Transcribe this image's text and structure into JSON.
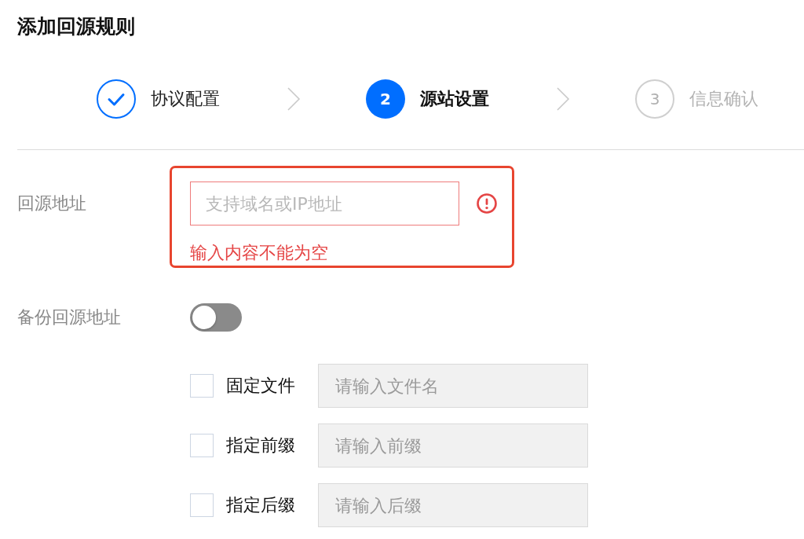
{
  "title": "添加回源规则",
  "steps": [
    {
      "label": "协议配置",
      "completed": true,
      "selected": false
    },
    {
      "number": "2",
      "label": "源站设置",
      "completed": false,
      "selected": true
    },
    {
      "number": "3",
      "label": "信息确认",
      "completed": false,
      "selected": false
    }
  ],
  "origin_address": {
    "label": "回源地址",
    "placeholder": "支持域名或IP地址",
    "invalid": true,
    "error": "输入内容不能为空"
  },
  "backup_address": {
    "label": "备份回源地址",
    "on": false
  },
  "rules": [
    {
      "label": "固定文件",
      "checked": false,
      "placeholder": "请输入文件名",
      "disabled": true
    },
    {
      "label": "指定前缀",
      "checked": false,
      "placeholder": "请输入前缀",
      "disabled": true
    },
    {
      "label": "指定后缀",
      "checked": false,
      "placeholder": "请输入后缀",
      "disabled": true
    }
  ]
}
